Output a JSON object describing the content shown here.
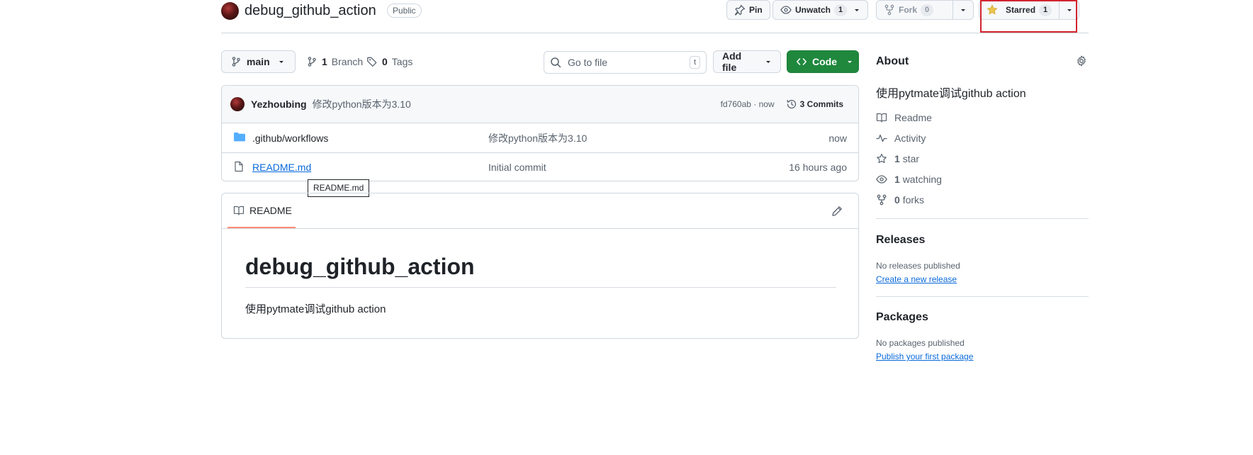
{
  "repo": {
    "name": "debug_github_action",
    "visibility": "Public"
  },
  "header_actions": {
    "pin_label": "Pin",
    "unwatch_label": "Unwatch",
    "watch_count": "1",
    "fork_label": "Fork",
    "fork_count": "0",
    "starred_label": "Starred",
    "star_count": "1"
  },
  "toolbar": {
    "branch": "main",
    "branch_count": "1",
    "branch_label": "Branch",
    "tag_count": "0",
    "tag_label": "Tags",
    "search_placeholder": "Go to file",
    "search_shortcut": "t",
    "add_file_label": "Add file",
    "code_label": "Code"
  },
  "latest_commit": {
    "author": "Yezhoubing",
    "message": "修改python版本为3.10",
    "hash_time": "fd760ab · now",
    "commits_label": "3 Commits"
  },
  "files": [
    {
      "name": ".github/workflows",
      "type": "folder",
      "message": "修改python版本为3.10",
      "time": "now"
    },
    {
      "name": "README.md",
      "type": "file",
      "message": "Initial commit",
      "time": "16 hours ago"
    }
  ],
  "tooltip": "README.md",
  "readme": {
    "tab_label": "README",
    "title": "debug_github_action",
    "body": "使用pytmate调试github action"
  },
  "sidebar": {
    "about_title": "About",
    "description": "使用pytmate调试github action",
    "links": {
      "readme": "Readme",
      "activity": "Activity",
      "stars_count": "1",
      "stars_label": "star",
      "watching_count": "1",
      "watching_label": "watching",
      "forks_count": "0",
      "forks_label": "forks"
    },
    "releases_title": "Releases",
    "releases_none": "No releases published",
    "releases_link": "Create a new release",
    "packages_title": "Packages",
    "packages_none": "No packages published",
    "packages_link": "Publish your first package"
  },
  "colors": {
    "code_button": "#1f883d",
    "link": "#0969da",
    "star": "#eac54f",
    "highlight": "#d1242f",
    "folder": "#54aeff"
  }
}
